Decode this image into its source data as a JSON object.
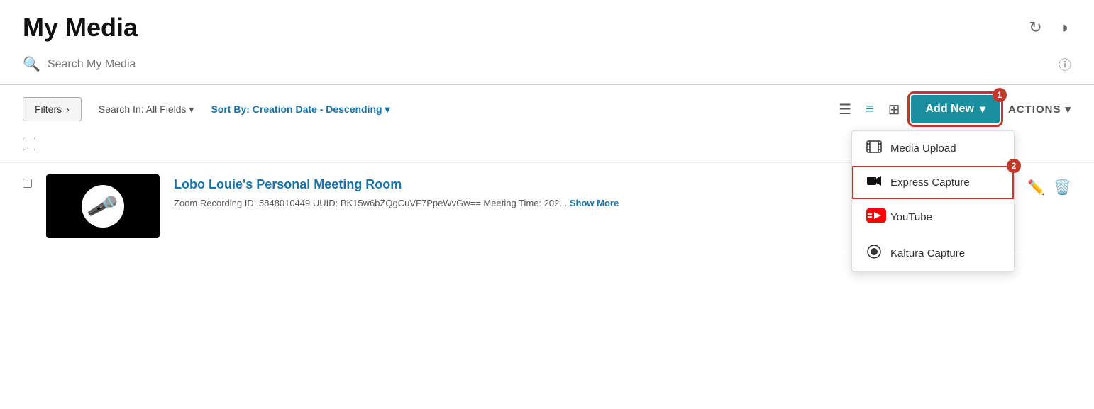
{
  "header": {
    "title": "My Media",
    "refresh_icon": "↻",
    "contrast_icon": "◑"
  },
  "search": {
    "placeholder": "Search My Media",
    "info_icon": "ⓘ"
  },
  "controls": {
    "filters_label": "Filters",
    "filters_arrow": "›",
    "search_in_label": "Search In: All Fields",
    "search_in_arrow": "▾",
    "sort_label": "Sort By: Creation Date - Descending",
    "sort_arrow": "▾",
    "view_icon1": "☰",
    "view_icon2": "≡",
    "view_icon3": "⊞",
    "add_new_label": "Add New",
    "add_new_arrow": "▾",
    "add_new_badge": "1",
    "actions_label": "ACTIONS",
    "actions_arrow": "▾"
  },
  "dropdown": {
    "items": [
      {
        "id": "media-upload",
        "icon_type": "film",
        "label": "Media Upload"
      },
      {
        "id": "express-capture",
        "icon_type": "video-camera",
        "label": "Express Capture",
        "badge": "2",
        "highlighted": true
      },
      {
        "id": "youtube",
        "icon_type": "youtube",
        "label": "YouTube"
      },
      {
        "id": "kaltura-capture",
        "icon_type": "record",
        "label": "Kaltura Capture"
      }
    ]
  },
  "media_list": {
    "items": [
      {
        "title": "Lobo Louie's Personal Meeting Room",
        "description": "Zoom Recording ID: 5848010449 UUID: BK15w6bZQgCuVF7PpeWvGw== Meeting Time: 202...",
        "show_more_label": "Show More"
      }
    ]
  }
}
